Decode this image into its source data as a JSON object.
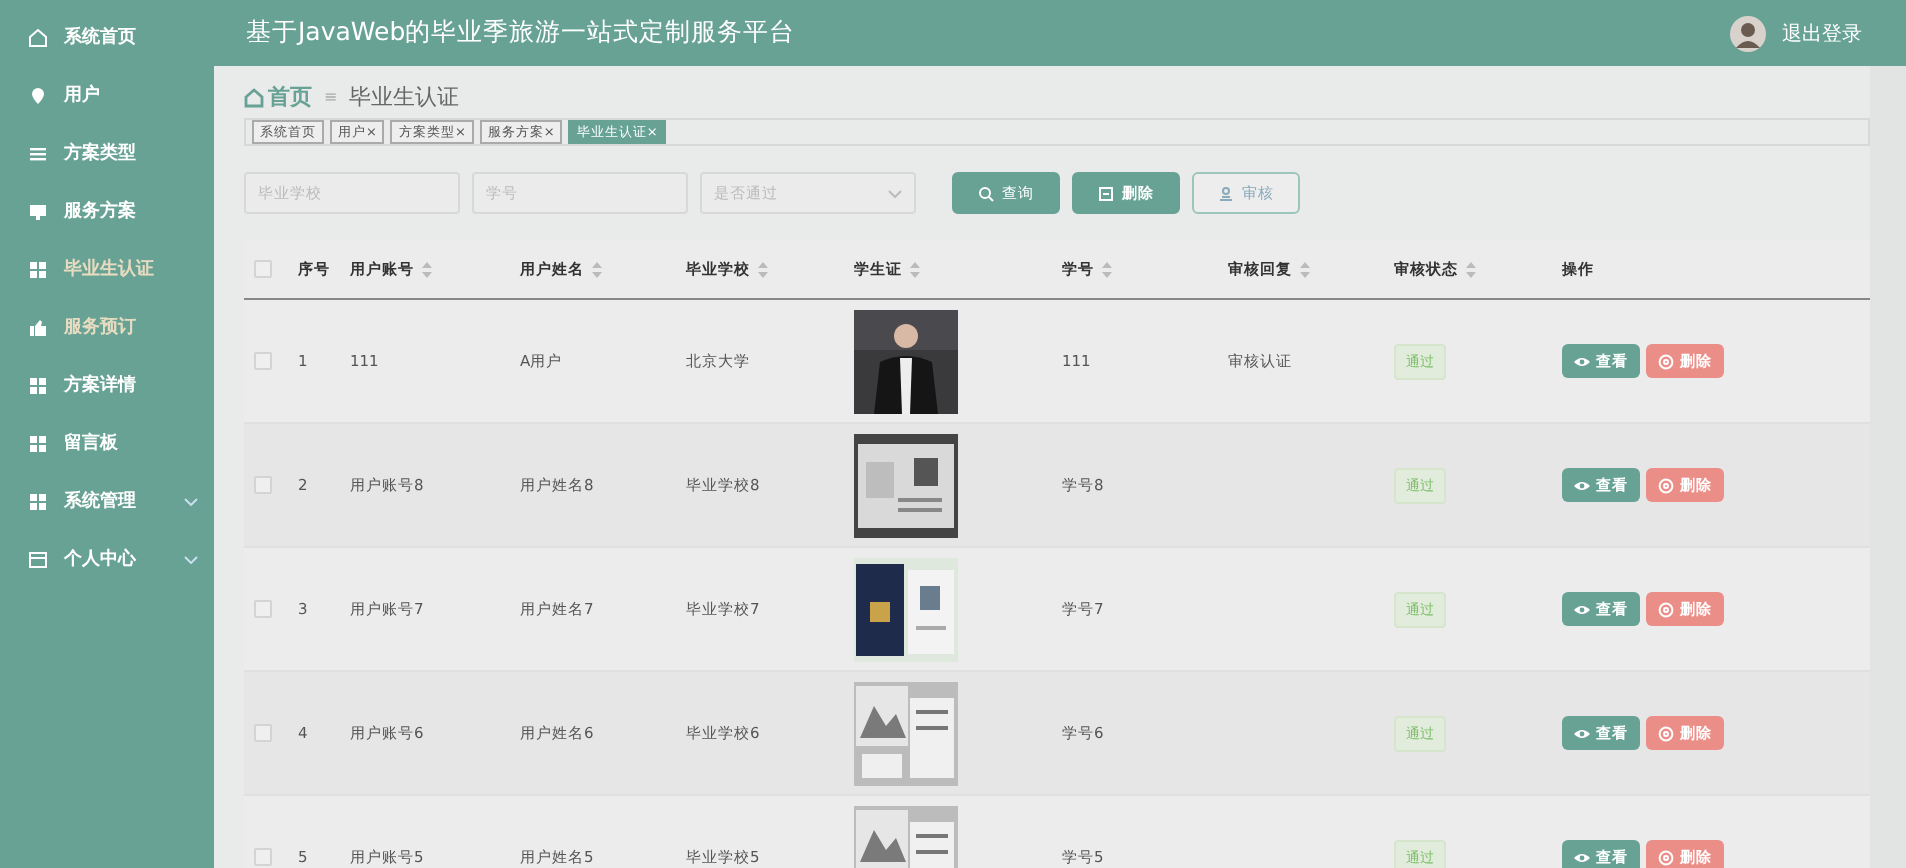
{
  "header": {
    "title": "基于JavaWeb的毕业季旅游一站式定制服务平台",
    "logout": "退出登录"
  },
  "sidebar": {
    "items": [
      {
        "label": "系统首页",
        "kind": "home",
        "selected": false,
        "expandable": false
      },
      {
        "label": "用户",
        "kind": "pin",
        "selected": false,
        "expandable": false
      },
      {
        "label": "方案类型",
        "kind": "list",
        "selected": false,
        "expandable": false
      },
      {
        "label": "服务方案",
        "kind": "monitor",
        "selected": false,
        "expandable": false
      },
      {
        "label": "毕业生认证",
        "kind": "grid",
        "selected": true,
        "expandable": false
      },
      {
        "label": "服务预订",
        "kind": "thumb",
        "selected": true,
        "expandable": false
      },
      {
        "label": "方案详情",
        "kind": "grid",
        "selected": false,
        "expandable": false
      },
      {
        "label": "留言板",
        "kind": "grid",
        "selected": false,
        "expandable": false
      },
      {
        "label": "系统管理",
        "kind": "grid",
        "selected": false,
        "expandable": true
      },
      {
        "label": "个人中心",
        "kind": "window",
        "selected": false,
        "expandable": true
      }
    ]
  },
  "breadcrumb": {
    "home": "首页",
    "separator": "≡",
    "current": "毕业生认证"
  },
  "tags": [
    {
      "label": "系统首页",
      "selected": false
    },
    {
      "label": "用户",
      "close": "×",
      "selected": false
    },
    {
      "label": "方案类型",
      "close": "×",
      "selected": false
    },
    {
      "label": "服务方案",
      "close": "×",
      "selected": false
    },
    {
      "label": "毕业生认证",
      "close": "×",
      "selected": true
    }
  ],
  "filters": [
    {
      "kind": "input",
      "placeholder": "毕业学校"
    },
    {
      "kind": "input",
      "placeholder": "学号"
    },
    {
      "kind": "select",
      "placeholder": "是否通过"
    }
  ],
  "actions": [
    {
      "kind": "search",
      "label": "查询"
    },
    {
      "kind": "delete",
      "label": "删除"
    },
    {
      "kind": "audit",
      "label": "审核"
    }
  ],
  "table": {
    "all_checked": false,
    "columns": [
      {
        "label": "序号",
        "sortable": false
      },
      {
        "label": "用户账号",
        "sortable": true
      },
      {
        "label": "用户姓名",
        "sortable": true
      },
      {
        "label": "毕业学校",
        "sortable": true
      },
      {
        "label": "学生证",
        "sortable": true
      },
      {
        "label": "学号",
        "sortable": true
      },
      {
        "label": "审核回复",
        "sortable": true
      },
      {
        "label": "审核状态",
        "sortable": true
      },
      {
        "label": "操作",
        "sortable": false
      }
    ],
    "rows": [
      {
        "index": "1",
        "account": "111",
        "name": "A用户",
        "school": "北京大学",
        "number": "111",
        "reply": "审核认证",
        "status": "通过",
        "checked": false,
        "actions": [
          {
            "kind": "view",
            "label": "查看"
          },
          {
            "kind": "delete",
            "label": "删除"
          }
        ]
      },
      {
        "index": "2",
        "account": "用户账号8",
        "name": "用户姓名8",
        "school": "毕业学校8",
        "number": "学号8",
        "status": "通过",
        "checked": false,
        "actions": [
          {
            "kind": "view",
            "label": "查看"
          },
          {
            "kind": "delete",
            "label": "删除"
          }
        ]
      },
      {
        "index": "3",
        "account": "用户账号7",
        "name": "用户姓名7",
        "school": "毕业学校7",
        "number": "学号7",
        "status": "通过",
        "checked": false,
        "actions": [
          {
            "kind": "view",
            "label": "查看"
          },
          {
            "kind": "delete",
            "label": "删除"
          }
        ]
      },
      {
        "index": "4",
        "account": "用户账号6",
        "name": "用户姓名6",
        "school": "毕业学校6",
        "number": "学号6",
        "status": "通过",
        "checked": false,
        "actions": [
          {
            "kind": "view",
            "label": "查看"
          },
          {
            "kind": "delete",
            "label": "删除"
          }
        ]
      },
      {
        "index": "5",
        "account": "用户账号5",
        "name": "用户姓名5",
        "school": "毕业学校5",
        "number": "学号5",
        "status": "通过",
        "checked": false,
        "actions": [
          {
            "kind": "view",
            "label": "查看"
          },
          {
            "kind": "delete",
            "label": "删除"
          }
        ]
      }
    ]
  }
}
